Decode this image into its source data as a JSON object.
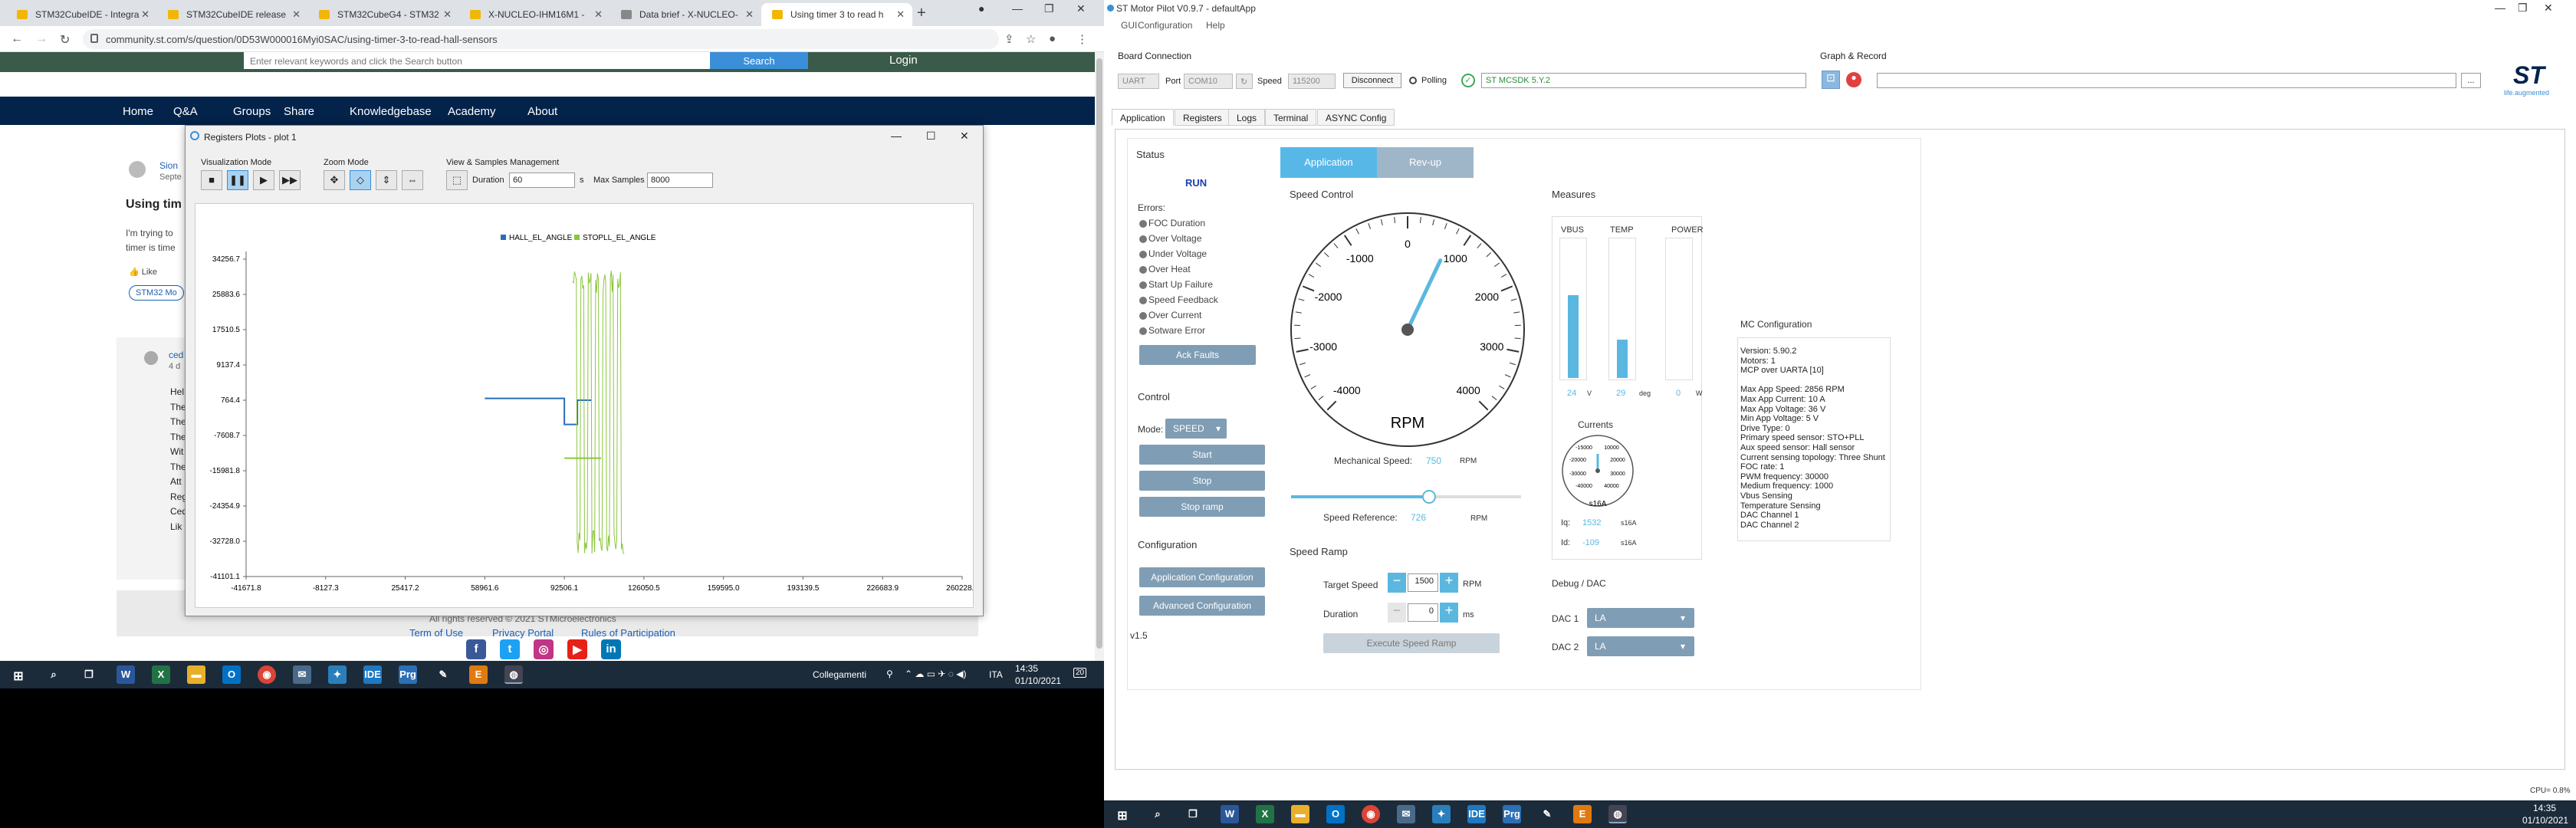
{
  "browser": {
    "tabs": [
      {
        "label": "STM32CubeIDE - Integra"
      },
      {
        "label": "STM32CubeIDE release"
      },
      {
        "label": "STM32CubeG4 - STM32"
      },
      {
        "label": "X-NUCLEO-IHM16M1 -"
      },
      {
        "label": "Data brief - X-NUCLEO-"
      },
      {
        "label": "Using timer 3 to read h"
      }
    ],
    "url": "community.st.com/s/question/0D53W000016Myi0SAC/using-timer-3-to-read-hall-sensors"
  },
  "site": {
    "search_placeholder": "Enter relevant keywords and click the Search button",
    "search_button": "Search",
    "login": "Login",
    "nav": [
      "Home",
      "Q&A",
      "Groups",
      "Share",
      "Knowledgebase",
      "Academy",
      "About"
    ],
    "question_title": "Using tim",
    "author": "Sion",
    "date": "Septe",
    "body1": "I'm trying to",
    "body2": "timer is time",
    "like": "Like",
    "tag": "STM32 Mo",
    "reply_author": "ced",
    "reply_date": "4 d",
    "reply_lines": [
      "Hel",
      "The",
      "The",
      "The",
      "Wit",
      "The",
      "Att",
      "Reg",
      "Ced",
      "Lik"
    ],
    "copyright": "All rights reserved © 2021 STMicroelectronics",
    "terms": "Term of Use",
    "privacy": "Privacy Portal",
    "rules": "Rules of Participation"
  },
  "plot_window": {
    "title": "Registers Plots - plot 1",
    "visualization_mode": "Visualization Mode",
    "zoom_mode": "Zoom Mode",
    "view_samples": "View & Samples Management",
    "duration_label": "Duration",
    "duration_value": "60",
    "duration_unit": "s",
    "max_samples_label": "Max Samples",
    "max_samples_value": "8000"
  },
  "chart_data": {
    "type": "line",
    "series": [
      {
        "name": "HALL_EL_ANGLE",
        "color": "#2a6ebb"
      },
      {
        "name": "STOPLL_EL_ANGLE",
        "color": "#8cc63f"
      }
    ],
    "yticks": [
      "34256.7",
      "25883.6",
      "17510.5",
      "9137.4",
      "764.4",
      "-7608.7",
      "-15981.8",
      "-24354.9",
      "-32728.0",
      "-41101.1"
    ],
    "xticks": [
      "-41671.8",
      "-8127.3",
      "25417.2",
      "58961.6",
      "92506.1",
      "126050.5",
      "159595.0",
      "193139.5",
      "226683.9",
      "260228.4"
    ],
    "xlim": [
      -41671.8,
      260228.4
    ],
    "ylim": [
      -41101.1,
      34256.7
    ],
    "hall_segments": [
      [
        58961.6,
        1200
      ],
      [
        92506.1,
        1200
      ],
      [
        92506.1,
        -5000
      ],
      [
        98000,
        -5000
      ],
      [
        98000,
        764.4
      ],
      [
        104000,
        764.4
      ]
    ],
    "stopll_segments": [
      [
        92506.1,
        -13000
      ],
      [
        108000,
        -13000
      ]
    ]
  },
  "taskbar": {
    "network": "Collegamenti",
    "lang": "ITA",
    "time": "14:35",
    "date": "01/10/2021",
    "notif": "20"
  },
  "motor_pilot": {
    "title": "ST Motor Pilot V0.9.7 - defaultApp",
    "menu": [
      "GUI",
      "Configuration",
      "Help"
    ],
    "board_connection": "Board Connection",
    "protocol": "UART",
    "port_label": "Port",
    "port": "COM10",
    "speed_label": "Speed",
    "speed": "115200",
    "disconnect": "Disconnect",
    "polling": "Polling",
    "board_name": "ST MCSDK 5.Y.2",
    "graph_record": "Graph & Record",
    "browse": "...",
    "logo": "life.augmented",
    "tabs": [
      "Application",
      "Registers",
      "Logs",
      "Terminal",
      "ASYNC Config"
    ],
    "status_title": "Status",
    "state": "RUN",
    "errors_label": "Errors:",
    "errors": [
      "FOC Duration",
      "Over Voltage",
      "Under Voltage",
      "Over Heat",
      "Start Up Failure",
      "Speed Feedback",
      "Over Current",
      "Sotware Error"
    ],
    "ack_faults": "Ack Faults",
    "control_title": "Control",
    "mode_label": "Mode:",
    "mode": "SPEED",
    "start": "Start",
    "stop": "Stop",
    "stop_ramp": "Stop ramp",
    "configuration": "Configuration",
    "app_config": "Application Configuration",
    "adv_config": "Advanced Configuration",
    "version": "v1.5",
    "app_tab": "Application",
    "revup_tab": "Rev-up",
    "speed_control": "Speed Control",
    "gauge_labels": [
      "-4000",
      "-3000",
      "-2000",
      "-1000",
      "0",
      "1000",
      "2000",
      "3000",
      "4000"
    ],
    "rpm": "RPM",
    "mech_speed_label": "Mechanical Speed:",
    "mech_speed": "750",
    "mech_unit": "RPM",
    "speed_ref_label": "Speed Reference:",
    "speed_ref": "726",
    "speed_ref_unit": "RPM",
    "speed_fraction": 0.6,
    "speed_ramp": "Speed Ramp",
    "target_label": "Target Speed",
    "target": "1500",
    "target_unit": "RPM",
    "duration_label": "Duration",
    "duration": "0",
    "duration_unit": "ms",
    "execute": "Execute Speed Ramp",
    "measures": "Measures",
    "vbus": "VBUS",
    "temp": "TEMP",
    "power": "POWER",
    "vbus_val": "24",
    "vbus_unit": "V",
    "temp_val": "29",
    "temp_unit": "deg",
    "power_val": "0",
    "power_unit": "W",
    "vbus_fill": 0.6,
    "temp_fill": 0.28,
    "power_fill": 0,
    "currents": "Currents",
    "cur_gauge": [
      "-15000",
      "10000",
      "-20000",
      "20000",
      "-30000",
      "30000",
      "-40000",
      "40000"
    ],
    "s16a": "s16A",
    "iq_label": "Iq:",
    "iq": "1532",
    "iq_unit": "s16A",
    "id_label": "Id:",
    "id": "-109",
    "id_unit": "s16A",
    "debug_dac": "Debug / DAC",
    "dac1_label": "DAC 1",
    "dac1": "LA",
    "dac2_label": "DAC 2",
    "dac2": "LA",
    "mc_title": "MC Configuration",
    "mc_lines": [
      "Version: 5.90.2",
      "Motors: 1",
      "MCP over UARTA [10]",
      "",
      "Max App Speed:   2856 RPM",
      "Max App Current: 10 A",
      "Max App Voltage: 36 V",
      "Min App Voltage: 5 V",
      "Drive Type:      0",
      "Primary speed sensor:   STO+PLL",
      "Aux speed sensor:       Hall sensor",
      "Current sensing topology: Three Shunt",
      "FOC rate:        1",
      "PWM frequency:           30000",
      "Medium frequency:        1000",
      "Vbus Sensing",
      "Temperature Sensing",
      "DAC Channel 1",
      "DAC Channel 2"
    ],
    "cpu": "CPU= 0.8%",
    "time": "14:35",
    "date": "01/10/2021"
  }
}
